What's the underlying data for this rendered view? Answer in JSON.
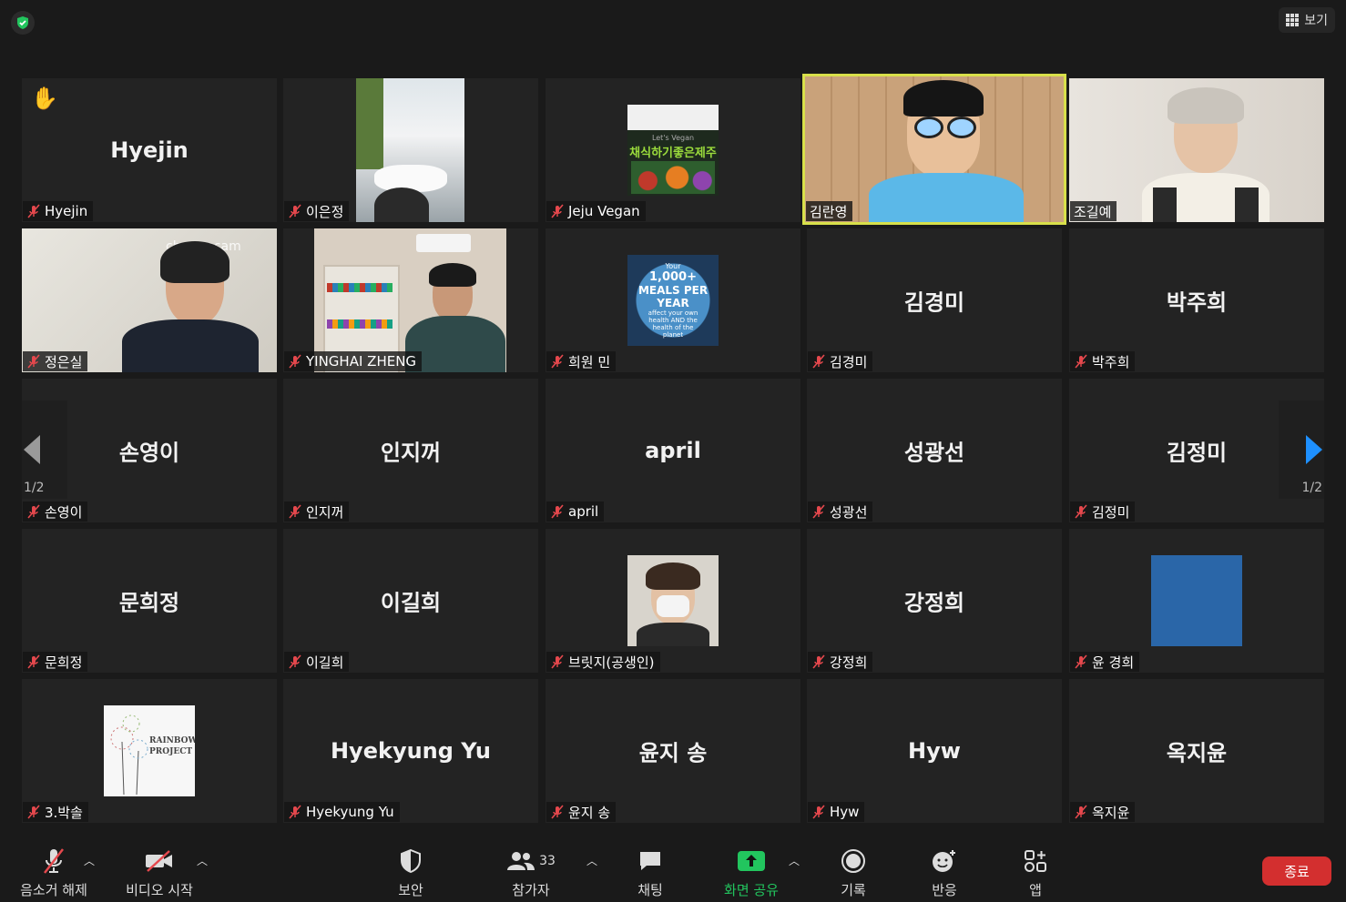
{
  "topbar": {
    "view_label": "보기"
  },
  "tiles": {
    "hyejin": {
      "center": "Hyejin",
      "label": "Hyejin"
    },
    "eunjeong": {
      "label": "이은정"
    },
    "jeju": {
      "label": "Jeju Vegan",
      "thumb_text": "채식하기좋은제주",
      "thumb_sub": "Let's Vegan"
    },
    "ranyoung": {
      "label": "김란영"
    },
    "gilye": {
      "label": "조길예"
    },
    "eunsil": {
      "label": "정은실",
      "watermark": "chromacam"
    },
    "yinghai": {
      "label": "YINGHAI ZHENG"
    },
    "heewon": {
      "label": "희원 민",
      "thumb_lines": [
        "Your",
        "1,000+",
        "MEALS PER",
        "YEAR",
        "affect your own",
        "health AND the",
        "health of the",
        "planet"
      ]
    },
    "kyungmi": {
      "center": "김경미",
      "label": "김경미"
    },
    "juhee": {
      "center": "박주희",
      "label": "박주희"
    },
    "youngi": {
      "center": "손영이",
      "label": "손영이"
    },
    "injiggeo": {
      "center": "인지꺼",
      "label": "인지꺼"
    },
    "april": {
      "center": "april",
      "label": "april"
    },
    "gwangseon": {
      "center": "성광선",
      "label": "성광선"
    },
    "jeongmi": {
      "center": "김정미",
      "label": "김정미"
    },
    "heejeong": {
      "center": "문희정",
      "label": "문희정"
    },
    "gilhee": {
      "center": "이길희",
      "label": "이길희"
    },
    "bridget": {
      "label": "브릿지(공생인)"
    },
    "junghee": {
      "center": "강정희",
      "label": "강정희"
    },
    "kyunghee": {
      "label": "윤 경희"
    },
    "parksol": {
      "label": "3.박솔",
      "thumb_line1": "RAINBOW",
      "thumb_line2": "PROJECT"
    },
    "hyekyung": {
      "center": "Hyekyung Yu",
      "label": "Hyekyung Yu"
    },
    "jisong": {
      "center": "윤지 송",
      "label": "윤지 송"
    },
    "hyw": {
      "center": "Hyw",
      "label": "Hyw"
    },
    "jiyun": {
      "center": "옥지윤",
      "label": "옥지윤"
    }
  },
  "pager": {
    "left": "1/2",
    "right": "1/2"
  },
  "toolbar": {
    "unmute": "음소거 해제",
    "start_video": "비디오 시작",
    "security": "보안",
    "participants": "참가자",
    "participants_count": "33",
    "chat": "채팅",
    "share": "화면 공유",
    "record": "기록",
    "reactions": "반응",
    "apps": "앱",
    "end": "종료"
  },
  "colors": {
    "active_speaker": "#d8e04a",
    "share_green": "#22c55e",
    "end_red": "#d32f2f",
    "muted_red": "#e5484d"
  }
}
